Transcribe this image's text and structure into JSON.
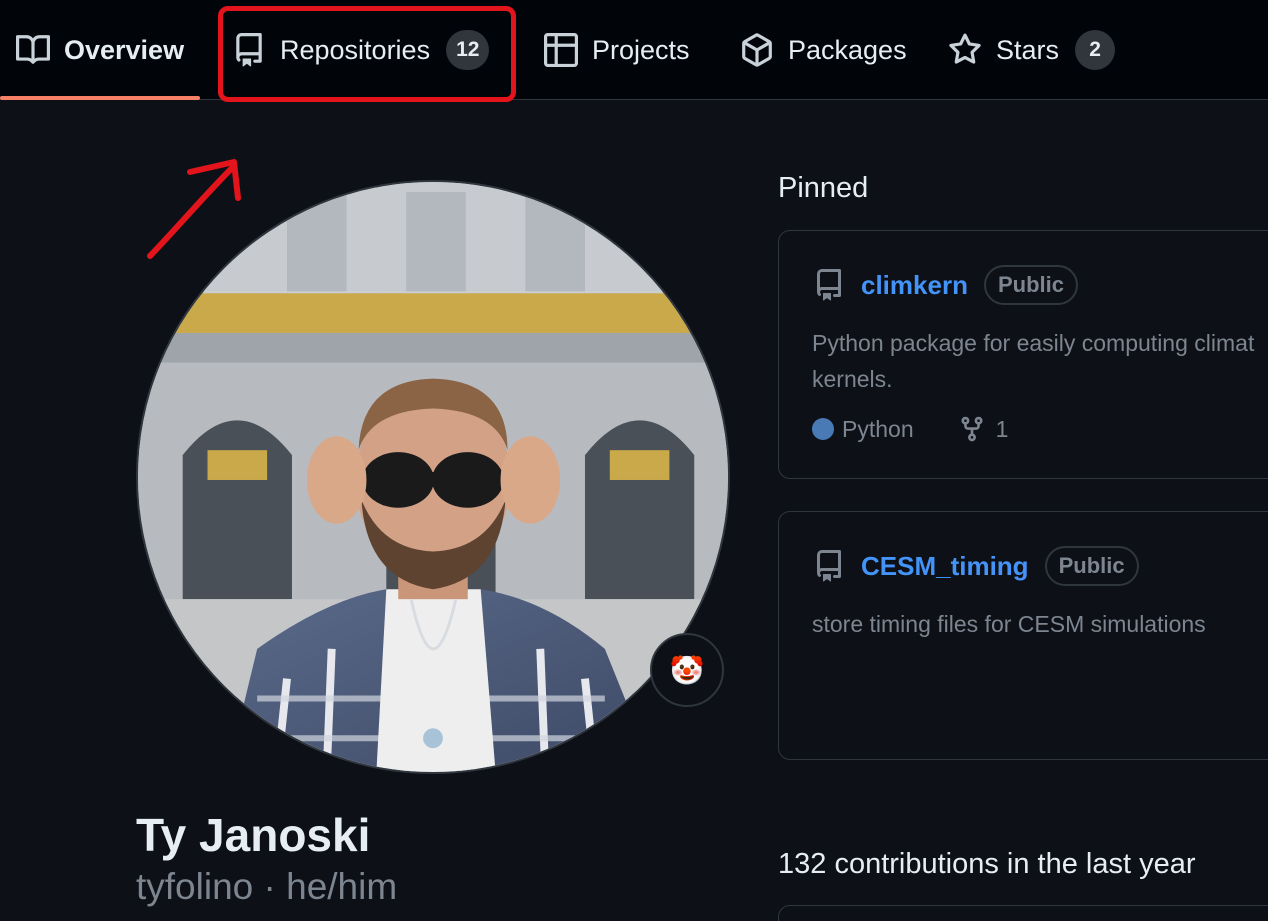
{
  "nav": {
    "tabs": [
      {
        "label": "Overview",
        "icon": "book-icon",
        "selected": true
      },
      {
        "label": "Repositories",
        "icon": "repo-icon",
        "count": "12"
      },
      {
        "label": "Projects",
        "icon": "table-icon"
      },
      {
        "label": "Packages",
        "icon": "package-icon"
      },
      {
        "label": "Stars",
        "icon": "star-icon",
        "count": "2"
      }
    ]
  },
  "colors": {
    "background": "#0d1117",
    "nav_background": "#010409",
    "selected_underline": "#f78166",
    "link": "#4493f8",
    "annotation": "#e3141b",
    "python": "#3572A5"
  },
  "profile": {
    "name": "Ty Janoski",
    "login_line": "tyfolino · he/him",
    "status_emoji": "🤡"
  },
  "pinned": {
    "title": "Pinned",
    "repos": [
      {
        "name": "climkern",
        "visibility": "Public",
        "description_line1": "Python package for easily computing climat",
        "description_line2": "kernels.",
        "language": "Python",
        "forks": "1"
      },
      {
        "name": "CESM_timing",
        "visibility": "Public",
        "description_line1": "store timing files for CESM simulations"
      }
    ]
  },
  "contributions": {
    "title": "132 contributions in the last year"
  }
}
